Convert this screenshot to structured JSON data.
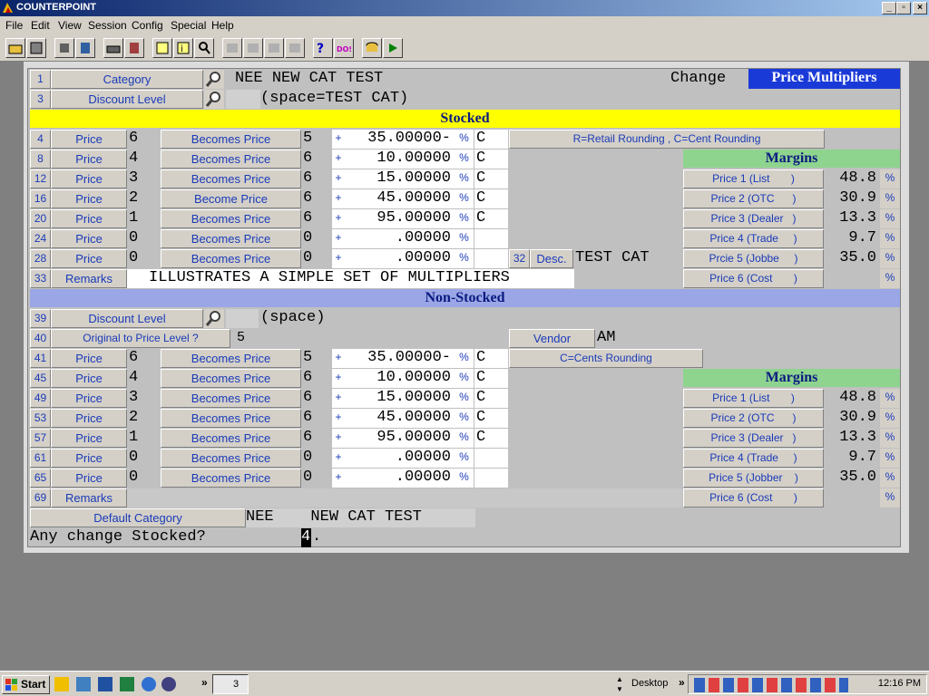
{
  "window": {
    "title": "COUNTERPOINT"
  },
  "menu": [
    "File",
    "Edit",
    "View",
    "Session",
    "Config",
    "Special",
    "Help"
  ],
  "header": {
    "category_label": "Category",
    "category_code": "NEE",
    "category_desc": "NEW CAT TEST",
    "discount_label": "Discount Level",
    "discount_value": "(space=TEST CAT)",
    "change_label": "Change",
    "mode_label": "Price Multipliers",
    "row1": "1",
    "row3": "3"
  },
  "stocked": {
    "title": "Stocked",
    "rows": [
      {
        "n": "4",
        "l": "Price",
        "lv": "6",
        "b": "Becomes Price",
        "t": "5",
        "amt": "35.00000-",
        "r": "C"
      },
      {
        "n": "8",
        "l": "Price",
        "lv": "4",
        "b": "Becomes Price",
        "t": "6",
        "amt": "10.00000",
        "r": "C"
      },
      {
        "n": "12",
        "l": "Price",
        "lv": "3",
        "b": "Becomes Price",
        "t": "6",
        "amt": "15.00000",
        "r": "C"
      },
      {
        "n": "16",
        "l": "Price",
        "lv": "2",
        "b": "Become Price",
        "t": "6",
        "amt": "45.00000",
        "r": "C"
      },
      {
        "n": "20",
        "l": "Price",
        "lv": "1",
        "b": "Becomes Price",
        "t": "6",
        "amt": "95.00000",
        "r": "C"
      },
      {
        "n": "24",
        "l": "Price",
        "lv": "0",
        "b": "Becomes Price",
        "t": "0",
        "amt": ".00000",
        "r": ""
      },
      {
        "n": "28",
        "l": "Price",
        "lv": "0",
        "b": "Becomes Price",
        "t": "0",
        "amt": ".00000",
        "r": ""
      }
    ],
    "rounding_note": "R=Retail Rounding , C=Cent Rounding",
    "desc_num": "32",
    "desc_label": "Desc.",
    "desc_value": "TEST CAT",
    "remarks_num": "33",
    "remarks_label": "Remarks",
    "remarks_value": "ILLUSTRATES A SIMPLE SET OF MULTIPLIERS",
    "margins_title": "Margins",
    "margins": [
      {
        "label": "Price 1 (List       )",
        "value": "48.8"
      },
      {
        "label": "Price 2 (OTC      )",
        "value": "30.9"
      },
      {
        "label": "Price 3 (Dealer   )",
        "value": "13.3"
      },
      {
        "label": "Price 4 (Trade     )",
        "value": "9.7"
      },
      {
        "label": "Prcie 5 (Jobbe     )",
        "value": "35.0"
      },
      {
        "label": "Price 6 (Cost       )",
        "value": ""
      }
    ]
  },
  "nonstocked": {
    "title": "Non-Stocked",
    "discount_num": "39",
    "discount_label": "Discount Level",
    "discount_value": "(space)",
    "orig_num": "40",
    "orig_label": "Original to Price Level ?",
    "orig_value": "5",
    "vendor_label": "Vendor",
    "vendor_value": "AM",
    "rounding_note": "C=Cents Rounding",
    "rows": [
      {
        "n": "41",
        "l": "Price",
        "lv": "6",
        "b": "Becomes Price",
        "t": "5",
        "amt": "35.00000-",
        "r": "C"
      },
      {
        "n": "45",
        "l": "Price",
        "lv": "4",
        "b": "Becomes Price",
        "t": "6",
        "amt": "10.00000",
        "r": "C"
      },
      {
        "n": "49",
        "l": "Price",
        "lv": "3",
        "b": "Becomes Price",
        "t": "6",
        "amt": "15.00000",
        "r": "C"
      },
      {
        "n": "53",
        "l": "Price",
        "lv": "2",
        "b": "Becomes Price",
        "t": "6",
        "amt": "45.00000",
        "r": "C"
      },
      {
        "n": "57",
        "l": "Price",
        "lv": "1",
        "b": "Becomes Price",
        "t": "6",
        "amt": "95.00000",
        "r": "C"
      },
      {
        "n": "61",
        "l": "Price",
        "lv": "0",
        "b": "Becomes Price",
        "t": "0",
        "amt": ".00000",
        "r": ""
      },
      {
        "n": "65",
        "l": "Price",
        "lv": "0",
        "b": "Becomes Price",
        "t": "0",
        "amt": ".00000",
        "r": ""
      }
    ],
    "remarks_num": "69",
    "remarks_label": "Remarks",
    "margins_title": "Margins",
    "margins": [
      {
        "label": "Price 1 (List       )",
        "value": "48.8"
      },
      {
        "label": "Price 2 (OTC      )",
        "value": "30.9"
      },
      {
        "label": "Price 3 (Dealer   )",
        "value": "13.3"
      },
      {
        "label": "Price 4 (Trade     )",
        "value": "9.7"
      },
      {
        "label": "Price 5 (Jobber    )",
        "value": "35.0"
      },
      {
        "label": "Price 6 (Cost       )",
        "value": ""
      }
    ]
  },
  "footer": {
    "default_label": "Default Category",
    "default_code": "NEE",
    "default_desc": "NEW CAT TEST",
    "prompt": "Any change Stocked?",
    "cursor": "4",
    "cursor_after": "."
  },
  "symbols": {
    "plus": "+",
    "percent": "%"
  },
  "taskbar": {
    "start": "Start",
    "desktop": "Desktop",
    "clock": "12:16 PM",
    "task_count": "3"
  }
}
